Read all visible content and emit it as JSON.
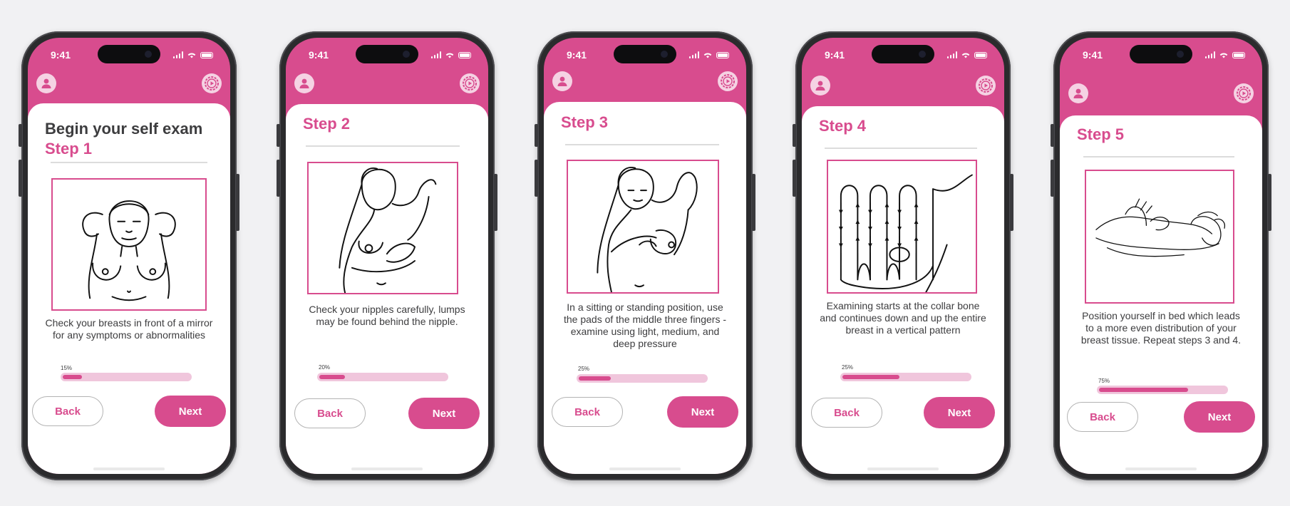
{
  "status": {
    "time": "9:41"
  },
  "icons": {
    "profile": "user-icon",
    "settings": "gear-play-icon"
  },
  "colors": {
    "accent": "#d84c8e",
    "track": "#f0c6dc",
    "text": "#3d3d3f"
  },
  "screens": [
    {
      "heading_intro": "Begin your self exam",
      "heading_step": "Step 1",
      "illustration": "woman-hands-behind-head-illustration",
      "description": "Check your breasts in front of a mirror for any symptoms or abnormalities",
      "progress_label": "15%",
      "progress_value": 0.15,
      "back_label": "Back",
      "next_label": "Next"
    },
    {
      "heading_intro": "",
      "heading_step": "Step 2",
      "illustration": "woman-checking-nipple-illustration",
      "description": "Check your nipples carefully, lumps may be found behind the nipple.",
      "progress_label": "20%",
      "progress_value": 0.2,
      "back_label": "Back",
      "next_label": "Next"
    },
    {
      "heading_intro": "",
      "heading_step": "Step 3",
      "illustration": "woman-raised-arm-pressing-illustration",
      "description": "In a sitting or standing position, use the pads of the middle three fingers - examine using light, medium, and deep pressure",
      "progress_label": "25%",
      "progress_value": 0.25,
      "back_label": "Back",
      "next_label": "Next"
    },
    {
      "heading_intro": "",
      "heading_step": "Step 4",
      "illustration": "vertical-pattern-diagram",
      "description": "Examining starts at the collar bone and continues down and up the entire breast in a vertical pattern",
      "progress_label": "25%",
      "progress_value": 0.45,
      "back_label": "Back",
      "next_label": "Next"
    },
    {
      "heading_intro": "",
      "heading_step": "Step 5",
      "illustration": "woman-lying-in-bed-illustration",
      "description": "Position yourself in bed which leads to a more even distribution of your breast tissue.  Repeat steps 3 and 4.",
      "progress_label": "75%",
      "progress_value": 0.7,
      "back_label": "Back",
      "next_label": "Next"
    }
  ]
}
